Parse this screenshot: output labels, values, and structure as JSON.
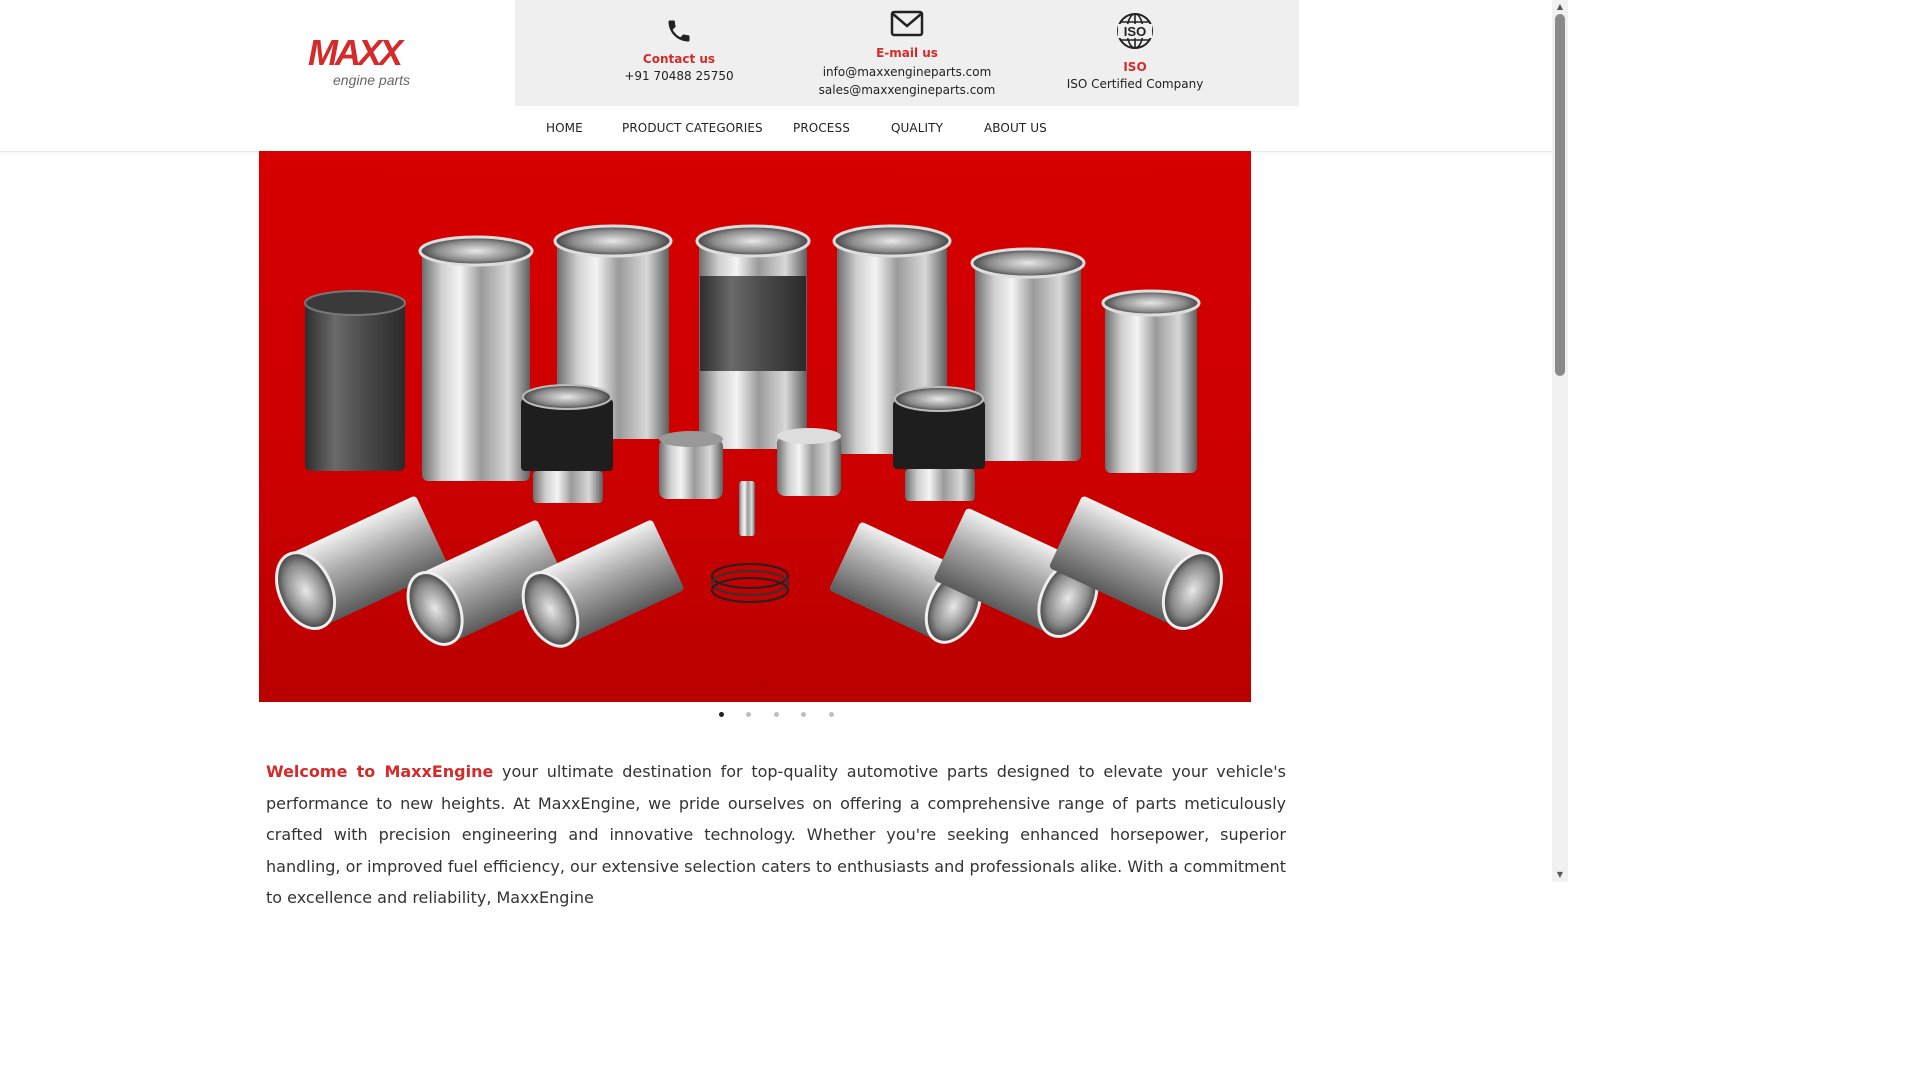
{
  "brand": {
    "logo_text": "MAXX",
    "logo_subtext": "engine parts"
  },
  "contact": {
    "phone": {
      "label": "Contact us",
      "value": "+91 70488 25750"
    },
    "email": {
      "label": "E-mail us",
      "values": [
        "info@maxxengineparts.com",
        "sales@maxxengineparts.com"
      ]
    },
    "iso": {
      "label": "ISO",
      "value": "ISO Certified Company",
      "icon_text": "ISO"
    }
  },
  "nav": {
    "items": [
      "HOME",
      "PRODUCT CATEGORIES",
      "PROCESS",
      "QUALITY",
      "ABOUT US"
    ]
  },
  "slider": {
    "slides": 5,
    "active_index": 0
  },
  "intro": {
    "highlight": "Welcome to MaxxEngine",
    "text": " your ultimate destination for top-quality automotive parts designed to elevate your vehicle's performance to new heights. At MaxxEngine, we pride ourselves on offering a comprehensive range of parts meticulously crafted with precision engineering and innovative technology. Whether you're seeking enhanced horsepower, superior handling, or improved fuel efficiency, our extensive selection caters to enthusiasts and professionals alike. With a commitment to excellence and reliability, MaxxEngine"
  },
  "colors": {
    "accent": "#d42a2a",
    "hero_bg": "#d60000",
    "panel_bg": "#efefef"
  }
}
